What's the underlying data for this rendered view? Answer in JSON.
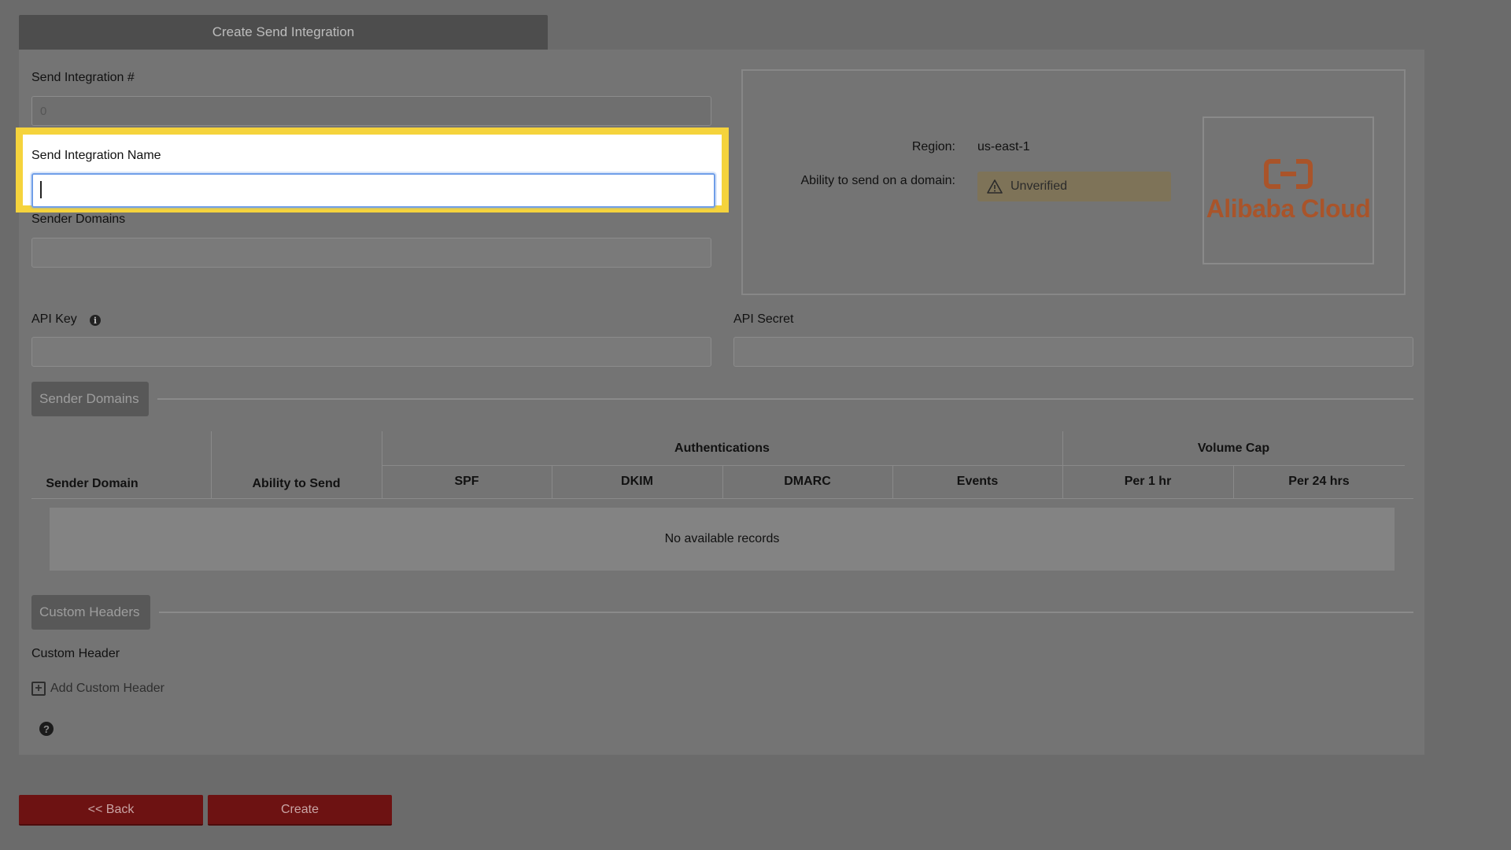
{
  "header": {
    "tab_title": "Create Send Integration"
  },
  "form": {
    "integration_number_label": "Send Integration #",
    "integration_number_value": "0",
    "integration_name_label": "Send Integration Name",
    "integration_name_value": "",
    "sender_domains_label": "Sender Domains",
    "api_key_label": "API Key",
    "api_secret_label": "API Secret"
  },
  "info_card": {
    "region_label": "Region:",
    "region_value": "us-east-1",
    "ability_label": "Ability to send on a domain:",
    "status_badge": "Unverified",
    "logo_text": "Alibaba Cloud",
    "brand_color": "#a9542a"
  },
  "sender_domains_section": {
    "button_label": "Sender Domains",
    "table": {
      "group_headers": [
        "Authentications",
        "Volume Cap"
      ],
      "columns": [
        "Sender Domain",
        "Ability to Send",
        "SPF",
        "DKIM",
        "DMARC",
        "Events",
        "Per 1 hr",
        "Per 24 hrs"
      ],
      "empty_text": "No available records"
    }
  },
  "custom_headers_section": {
    "button_label": "Custom Headers",
    "field_label": "Custom Header",
    "add_link": "Add Custom Header"
  },
  "footer": {
    "back_label": "<< Back",
    "create_label": "Create"
  }
}
